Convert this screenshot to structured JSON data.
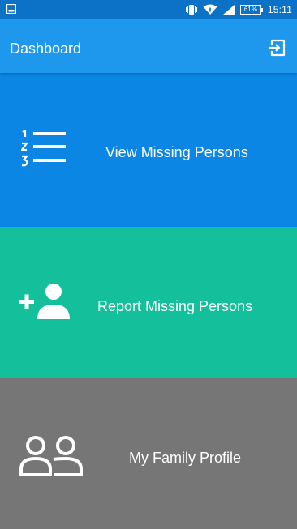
{
  "status_bar": {
    "battery_level": "61%",
    "time": "15:11",
    "icons": [
      "screen-icon",
      "vibrate-icon",
      "wifi-icon",
      "signal-icon",
      "battery-icon"
    ]
  },
  "app_bar": {
    "title": "Dashboard",
    "action_icon": "logout-icon"
  },
  "tiles": [
    {
      "label": "View Missing Persons",
      "icon": "numbered-list-icon",
      "color": "#0b86e5"
    },
    {
      "label": "Report Missing Persons",
      "icon": "add-person-icon",
      "color": "#14c09b"
    },
    {
      "label": "My Family Profile",
      "icon": "group-icon",
      "color": "#767676"
    }
  ],
  "colors": {
    "status_bar": "#0b72c8",
    "app_bar": "#1e98ec",
    "text": "#ffffff"
  }
}
